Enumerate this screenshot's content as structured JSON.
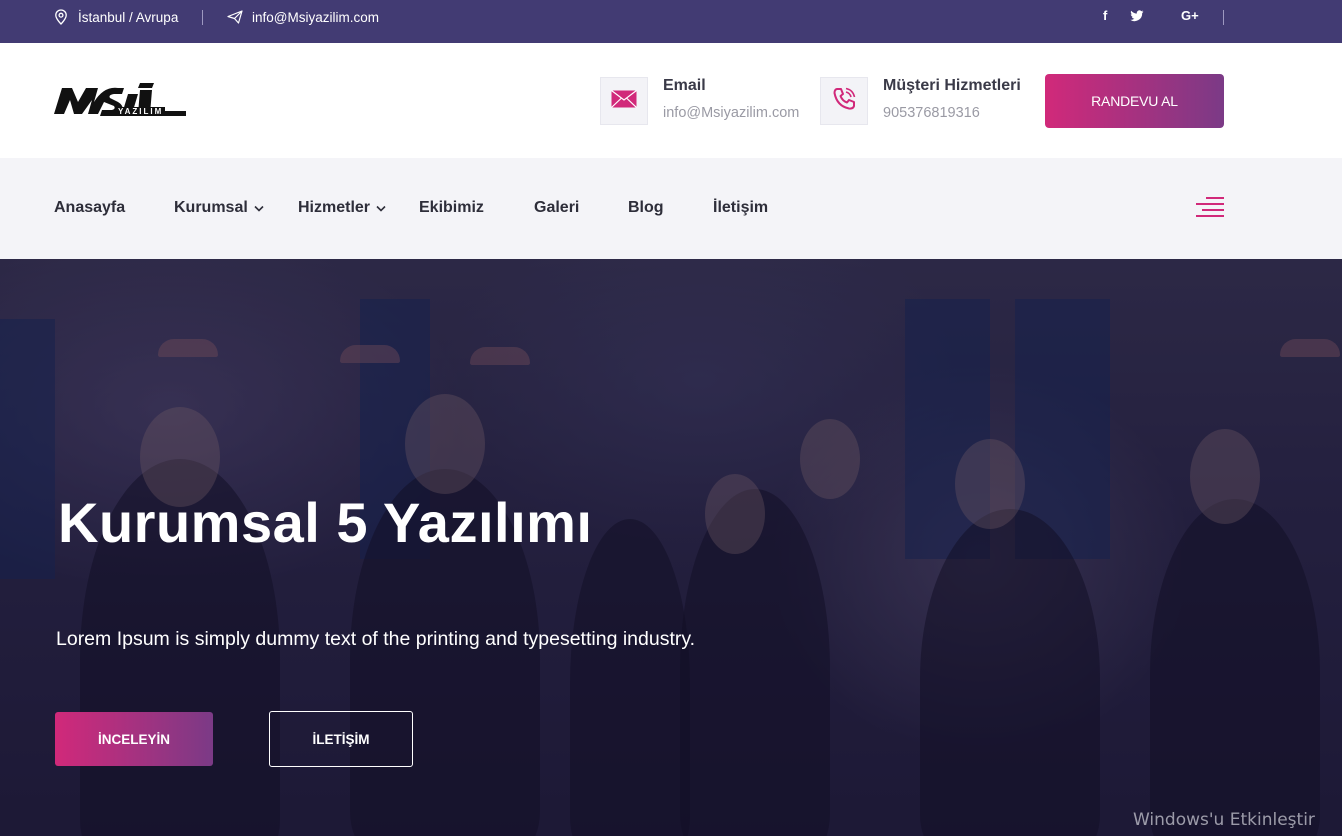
{
  "topbar": {
    "location": "İstanbul / Avrupa",
    "email": "info@Msiyazilim.com",
    "social": [
      "f",
      "t",
      "G+"
    ],
    "icons": [
      "location-pin-icon",
      "paper-plane-icon",
      "facebook-icon",
      "twitter-icon",
      "google-plus-icon"
    ]
  },
  "header": {
    "logo_text": "MSİ",
    "logo_sub": "YAZILIM",
    "email_title": "Email",
    "email_value": "info@Msiyazilim.com",
    "service_title": "Müşteri Hizmetleri",
    "service_value": "905376819316",
    "cta_label": "RANDEVU AL"
  },
  "nav": {
    "items": [
      {
        "label": "Anasayfa"
      },
      {
        "label": "Kurumsal"
      },
      {
        "label": "Hizmetler"
      },
      {
        "label": "Ekibimiz"
      },
      {
        "label": "Galeri"
      },
      {
        "label": "Blog"
      },
      {
        "label": "İletişim"
      }
    ]
  },
  "hero": {
    "title": "Kurumsal 5 Yazılımı",
    "text": "Lorem Ipsum is simply dummy text of the printing and typesetting industry.",
    "primary_button": "İNCELEYİN",
    "secondary_button": "İLETİŞİM"
  },
  "system": {
    "watermark": "Windows'u Etkinleştir"
  },
  "colors": {
    "topbar": "#423b73",
    "accent_start": "#d1297a",
    "accent_end": "#7b3a86",
    "nav_bg": "#f4f4f8"
  }
}
